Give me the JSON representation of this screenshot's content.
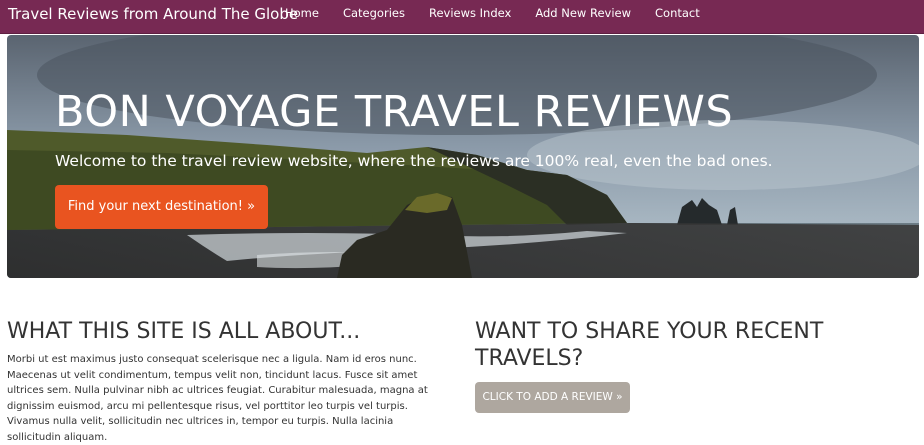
{
  "navbar": {
    "brand": "Travel Reviews from Around The Globe",
    "links": [
      "Home",
      "Categories",
      "Reviews Index",
      "Add New Review",
      "Contact"
    ]
  },
  "hero": {
    "title": "BON VOYAGE TRAVEL REVIEWS",
    "subtitle": "Welcome to the travel review website, where the reviews are 100% real, even the bad ones.",
    "button": "Find your next destination! »"
  },
  "about": {
    "heading": "WHAT THIS SITE IS ALL ABOUT...",
    "text": "Morbi ut est maximus justo consequat scelerisque nec a ligula. Nam id eros nunc. Maecenas ut velit condimentum, tempus velit non, tincidunt lacus. Fusce sit amet ultrices sem. Nulla pulvinar nibh ac ultrices feugiat. Curabitur malesuada, magna at dignissim euismod, arcu mi pellentesque risus, vel porttitor leo turpis vel turpis. Vivamus nulla velit, sollicitudin nec ultrices in, tempor eu turpis. Nulla lacinia sollicitudin aliquam."
  },
  "share": {
    "heading": "WANT TO SHARE YOUR RECENT TRAVELS?",
    "button": "CLICK TO ADD A REVIEW »"
  },
  "colors": {
    "navbar": "#772953",
    "primary_button": "#e95420",
    "secondary_button": "#aea79f"
  }
}
